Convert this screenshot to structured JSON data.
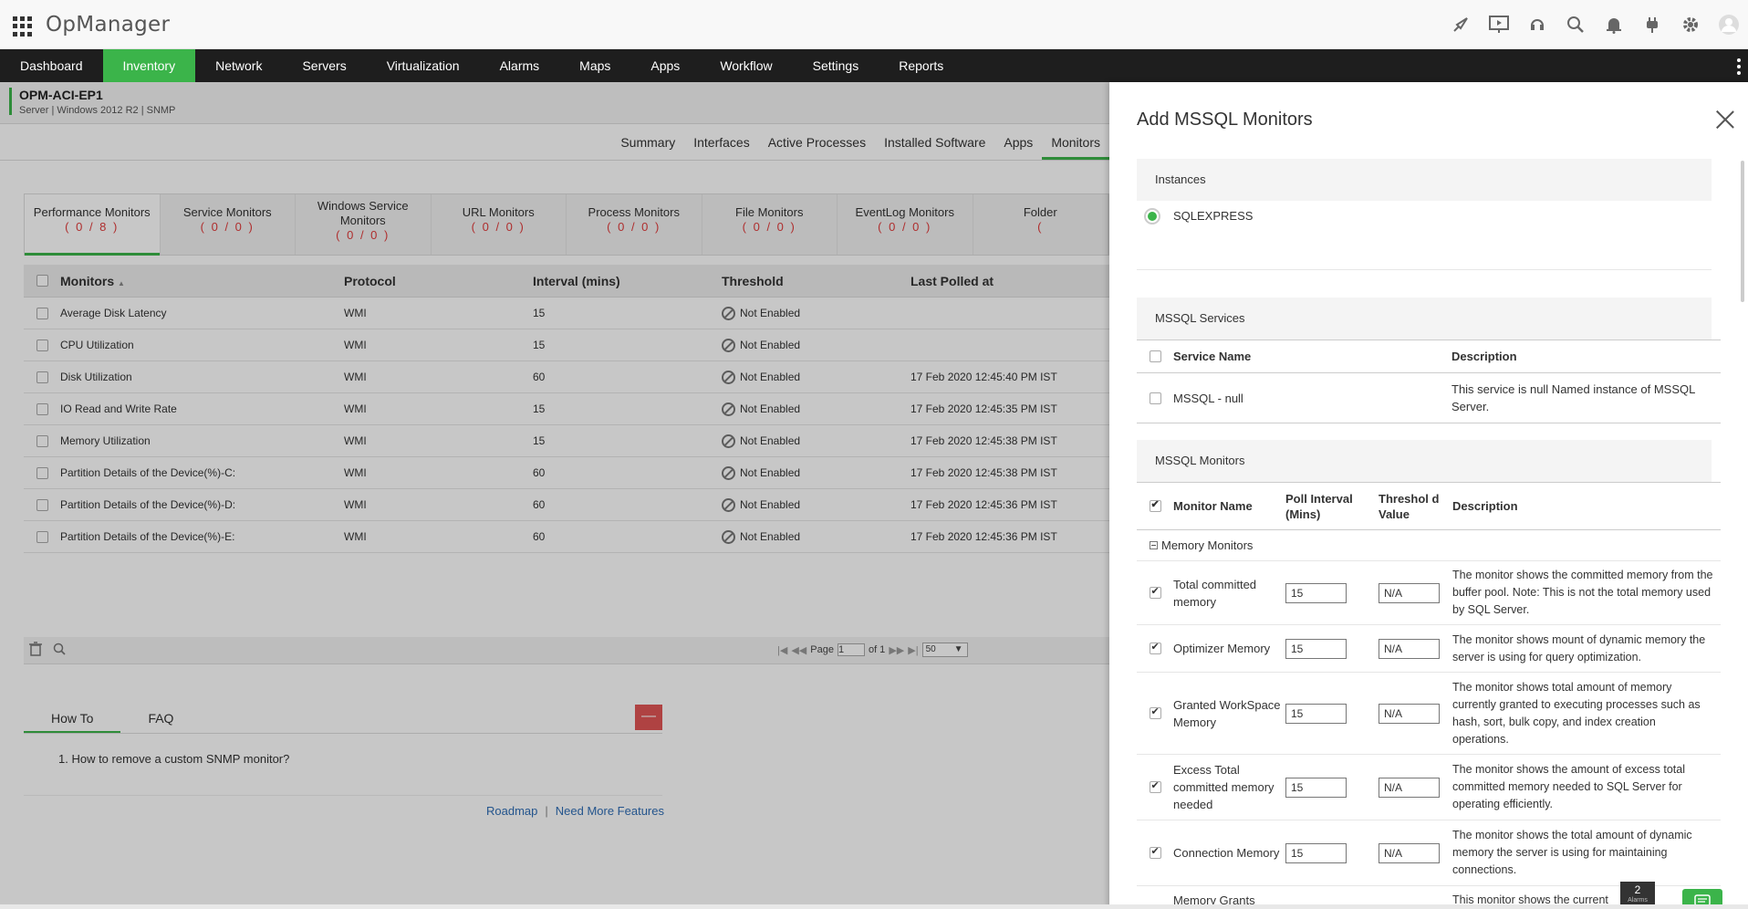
{
  "header": {
    "logo": "OpManager"
  },
  "nav": {
    "items": [
      "Dashboard",
      "Inventory",
      "Network",
      "Servers",
      "Virtualization",
      "Alarms",
      "Maps",
      "Apps",
      "Workflow",
      "Settings",
      "Reports"
    ]
  },
  "device": {
    "name": "OPM-ACI-EP1",
    "subtitle": "Server | Windows 2012 R2 | SNMP"
  },
  "subtabs": [
    "Summary",
    "Interfaces",
    "Active Processes",
    "Installed Software",
    "Apps",
    "Monitors"
  ],
  "monitor_tabs": [
    {
      "label": "Performance Monitors",
      "count": "( 0 / 8 )"
    },
    {
      "label": "Service Monitors",
      "count": "( 0 / 0 )"
    },
    {
      "label": "Windows Service Monitors",
      "count": "( 0 / 0 )"
    },
    {
      "label": "URL Monitors",
      "count": "( 0 / 0 )"
    },
    {
      "label": "Process Monitors",
      "count": "( 0 / 0 )"
    },
    {
      "label": "File Monitors",
      "count": "( 0 / 0 )"
    },
    {
      "label": "EventLog Monitors",
      "count": "( 0 / 0 )"
    },
    {
      "label": "Folder",
      "count": "("
    }
  ],
  "table": {
    "headers": [
      "Monitors",
      "Protocol",
      "Interval (mins)",
      "Threshold",
      "Last Polled at"
    ],
    "rows": [
      {
        "name": "Average Disk Latency",
        "protocol": "WMI",
        "interval": "15",
        "threshold": "Not Enabled",
        "last": ""
      },
      {
        "name": "CPU Utilization",
        "protocol": "WMI",
        "interval": "15",
        "threshold": "Not Enabled",
        "last": ""
      },
      {
        "name": "Disk Utilization",
        "protocol": "WMI",
        "interval": "60",
        "threshold": "Not Enabled",
        "last": "17 Feb 2020 12:45:40 PM IST"
      },
      {
        "name": "IO Read and Write Rate",
        "protocol": "WMI",
        "interval": "15",
        "threshold": "Not Enabled",
        "last": "17 Feb 2020 12:45:35 PM IST"
      },
      {
        "name": "Memory Utilization",
        "protocol": "WMI",
        "interval": "15",
        "threshold": "Not Enabled",
        "last": "17 Feb 2020 12:45:38 PM IST"
      },
      {
        "name": "Partition Details of the Device(%)-C:",
        "protocol": "WMI",
        "interval": "60",
        "threshold": "Not Enabled",
        "last": "17 Feb 2020 12:45:38 PM IST"
      },
      {
        "name": "Partition Details of the Device(%)-D:",
        "protocol": "WMI",
        "interval": "60",
        "threshold": "Not Enabled",
        "last": "17 Feb 2020 12:45:36 PM IST"
      },
      {
        "name": "Partition Details of the Device(%)-E:",
        "protocol": "WMI",
        "interval": "60",
        "threshold": "Not Enabled",
        "last": "17 Feb 2020 12:45:36 PM IST"
      }
    ],
    "pager": {
      "page_label": "Page",
      "page_value": "1",
      "of_label": "of 1",
      "per_page": "50"
    }
  },
  "help": {
    "tabs": [
      "How To",
      "FAQ"
    ],
    "collapse": "—",
    "items": [
      "1. How to remove a custom SNMP monitor?"
    ]
  },
  "links": {
    "roadmap": "Roadmap",
    "sep": "|",
    "more": "Need More Features"
  },
  "panel": {
    "title": "Add MSSQL Monitors",
    "instances_label": "Instances",
    "instance": "SQLEXPRESS",
    "services_label": "MSSQL Services",
    "services_headers": [
      "Service Name",
      "Description"
    ],
    "services": [
      {
        "name": "MSSQL - null",
        "desc": "This service is null Named instance of MSSQL Server."
      }
    ],
    "monitors_label": "MSSQL Monitors",
    "monitors_headers": [
      "Monitor Name",
      "Poll Interval (Mins)",
      "Threshol d Value",
      "Description"
    ],
    "group": "Memory Monitors",
    "monitors": [
      {
        "name": "Total committed memory",
        "poll": "15",
        "thr": "N/A",
        "desc": "The monitor shows the committed memory from the buffer pool. Note: This is not the total memory used by SQL Server."
      },
      {
        "name": "Optimizer Memory",
        "poll": "15",
        "thr": "N/A",
        "desc": "The monitor shows mount of dynamic memory the server is using for query optimization."
      },
      {
        "name": "Granted WorkSpace Memory",
        "poll": "15",
        "thr": "N/A",
        "desc": "The monitor shows total amount of memory currently granted to executing processes such as hash, sort, bulk copy, and index creation operations."
      },
      {
        "name": "Excess Total committed memory needed",
        "poll": "15",
        "thr": "N/A",
        "desc": "The monitor shows the amount of excess total committed memory needed to SQL Server for operating efficiently."
      },
      {
        "name": "Connection Memory",
        "poll": "15",
        "thr": "N/A",
        "desc": "The monitor shows the total amount of dynamic memory the server is using for maintaining connections."
      },
      {
        "name": "Memory Grants",
        "poll": "",
        "thr": "",
        "desc": "This monitor shows the current"
      }
    ],
    "alarm_count": "2",
    "alarm_label": "Alarms"
  }
}
